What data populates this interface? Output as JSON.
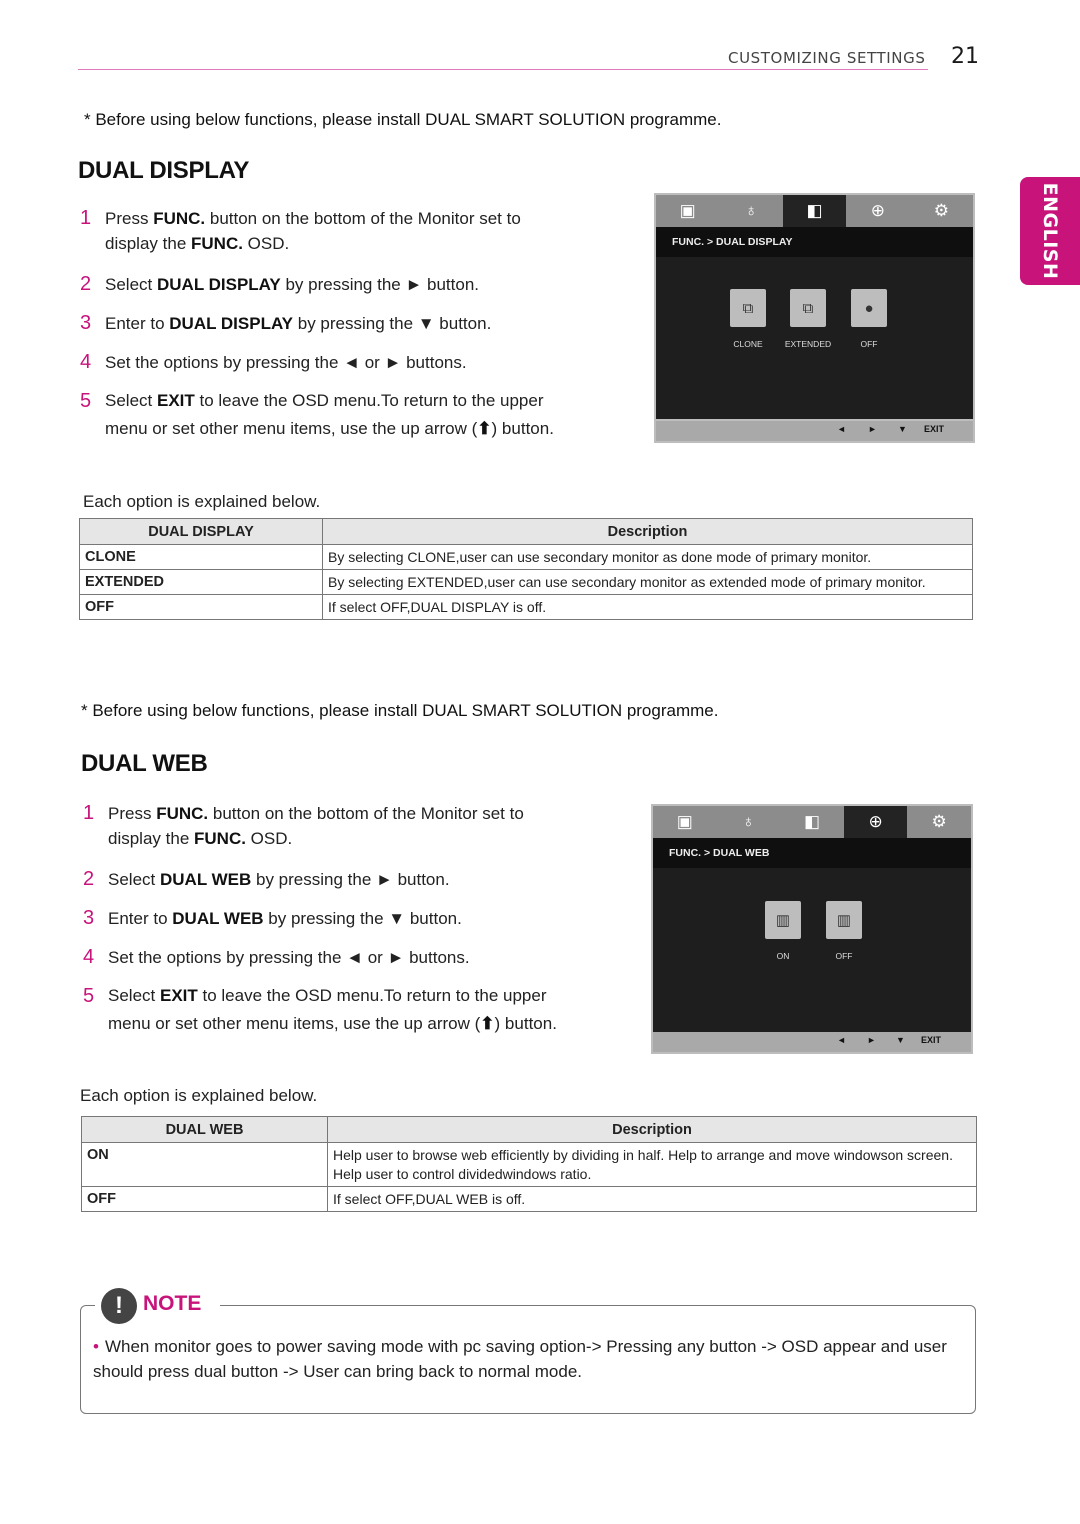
{
  "header": {
    "section": "CUSTOMIZING SETTINGS",
    "page_number": "21",
    "language_tab": "ENGLISH"
  },
  "dual_display": {
    "prereq_note": "* Before using below functions, please install DUAL SMART SOLUTION programme.",
    "title": "DUAL DISPLAY",
    "steps": [
      {
        "num": "1",
        "pre": "Press ",
        "b1": "FUNC.",
        "mid": " button on the bottom of the Monitor set to display the ",
        "b2": "FUNC.",
        "post": " OSD."
      },
      {
        "num": "2",
        "pre": "Select ",
        "b1": "DUAL DISPLAY",
        "post": " by pressing the ► button."
      },
      {
        "num": "3",
        "pre": "Enter to ",
        "b1": "DUAL DISPLAY",
        "post": " by pressing the ▼ button."
      },
      {
        "num": "4",
        "pre": "Set the options by pressing the ◄ or ► buttons."
      },
      {
        "num": "5",
        "pre": "Select ",
        "b1": "EXIT",
        "post": " to leave the OSD menu.To return to the upper menu or set other menu items, use the up arrow (",
        "arrow": "⬆",
        "post2": ") button."
      }
    ],
    "explain": "Each option is explained below.",
    "osd": {
      "breadcrumb": "FUNC.  >  DUAL DISPLAY",
      "tabs": [
        "picture-icon",
        "bulb-icon",
        "dual-display-icon",
        "globe-icon",
        "gear-icon"
      ],
      "active_tab": 2,
      "options": [
        "CLONE",
        "EXTENDED",
        "OFF"
      ],
      "controls": [
        "◄",
        "►",
        "▼",
        "EXIT"
      ]
    },
    "table": {
      "headers": [
        "DUAL DISPLAY",
        "Description"
      ],
      "rows": [
        {
          "key": "CLONE",
          "desc": "By selecting CLONE,user can use secondary monitor as done mode of primary monitor."
        },
        {
          "key": "EXTENDED",
          "desc": "By selecting EXTENDED,user can use secondary monitor as extended mode of primary monitor."
        },
        {
          "key": "OFF",
          "desc": "If select OFF,DUAL DISPLAY is off."
        }
      ]
    }
  },
  "dual_web": {
    "prereq_note": "* Before using below functions, please install DUAL SMART SOLUTION programme.",
    "title": "DUAL WEB",
    "steps": [
      {
        "num": "1",
        "pre": "Press ",
        "b1": "FUNC.",
        "mid": " button on the bottom of the Monitor set to display the ",
        "b2": "FUNC.",
        "post": " OSD."
      },
      {
        "num": "2",
        "pre": "Select ",
        "b1": "DUAL WEB",
        "post": " by pressing the ► button."
      },
      {
        "num": "3",
        "pre": "Enter to ",
        "b1": "DUAL WEB",
        "post": " by pressing the ▼ button."
      },
      {
        "num": "4",
        "pre": "Set the options by pressing the ◄ or ► buttons."
      },
      {
        "num": "5",
        "pre": "Select ",
        "b1": "EXIT",
        "post": " to leave the OSD menu.To return to the upper menu or set other menu items, use the up arrow (",
        "arrow": "⬆",
        "post2": ") button."
      }
    ],
    "explain": "Each option is explained below.",
    "osd": {
      "breadcrumb": "FUNC.  >  DUAL WEB",
      "tabs": [
        "picture-icon",
        "bulb-icon",
        "dual-display-icon",
        "globe-icon",
        "gear-icon"
      ],
      "active_tab": 3,
      "options": [
        "ON",
        "OFF"
      ],
      "controls": [
        "◄",
        "►",
        "▼",
        "EXIT"
      ]
    },
    "table": {
      "headers": [
        "DUAL WEB",
        "Description"
      ],
      "rows": [
        {
          "key": "ON",
          "desc": "Help user to browse web efficiently by dividing in half. Help to arrange and move windowson screen. Help user to control dividedwindows ratio."
        },
        {
          "key": "OFF",
          "desc": "If select OFF,DUAL WEB is off."
        }
      ]
    }
  },
  "note": {
    "title": "NOTE",
    "icon": "!",
    "bullet": "•",
    "text": "When monitor goes to power saving mode with pc saving option-> Pressing any button -> OSD appear and user should press dual button -> User can bring back to normal mode."
  },
  "colors": {
    "accent": "#c8137b",
    "header_rule": "#e07ac0"
  }
}
